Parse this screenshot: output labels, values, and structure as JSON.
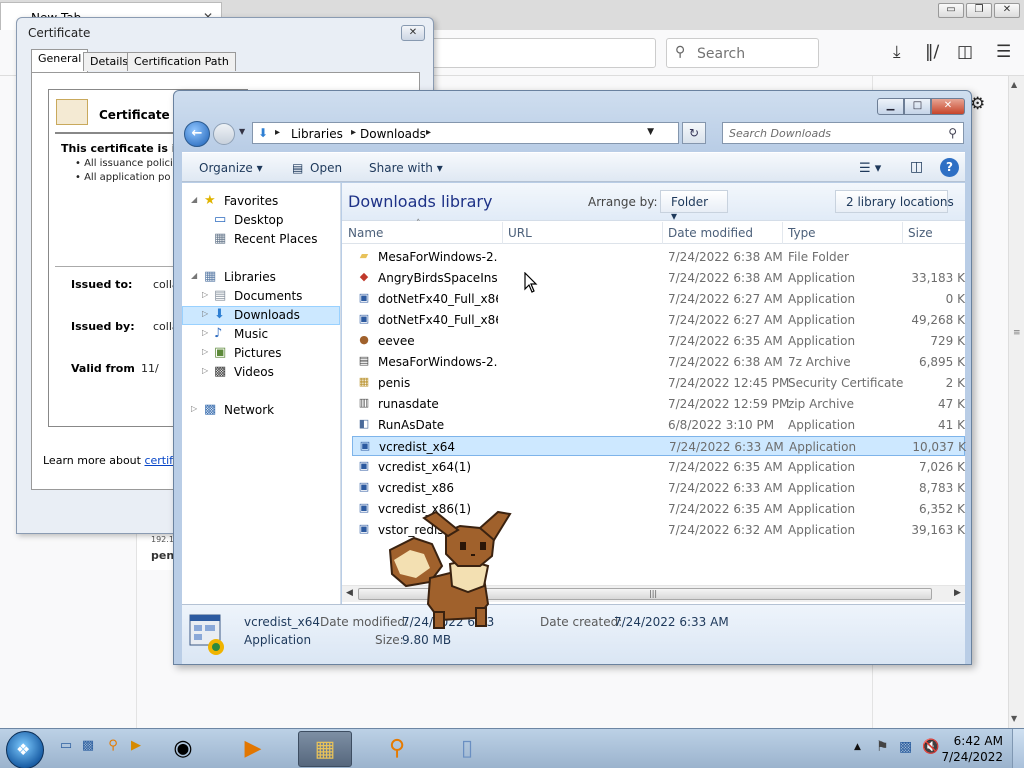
{
  "browser": {
    "tab_title": "New Tab",
    "search_placeholder": "Search",
    "win_min": "▭",
    "win_max": "❐",
    "win_close": "✕",
    "tab_close": "✕",
    "card_ip": "192.1",
    "card_name": "pen"
  },
  "cert": {
    "title": "Certificate",
    "close": "✕",
    "tabs": [
      "General",
      "Details",
      "Certification Path"
    ],
    "info_title": "Certificate Inf",
    "intended": "This certificate is int",
    "bullets": [
      "• All issuance polici",
      "• All application po"
    ],
    "issued_to_label": "Issued to:",
    "issued_to_value": "colla",
    "issued_by_label": "Issued by:",
    "issued_by_value": "colla",
    "valid_from_label": "Valid from",
    "valid_from_value": "11/",
    "learn_prefix": "Learn more about ",
    "learn_link": "certificat"
  },
  "explorer": {
    "title_buttons": {
      "min": "▁",
      "max": "□",
      "close": "✕"
    },
    "address": {
      "crumbs": [
        "Libraries",
        "Downloads"
      ]
    },
    "search_placeholder": "Search Downloads",
    "commands": {
      "organize": "Organize ▾",
      "open": "Open",
      "share": "Share with ▾"
    },
    "help": "?",
    "nav": {
      "favorites": "Favorites",
      "desktop": "Desktop",
      "recent": "Recent Places",
      "libraries": "Libraries",
      "documents": "Documents",
      "downloads": "Downloads",
      "music": "Music",
      "pictures": "Pictures",
      "videos": "Videos",
      "network": "Network"
    },
    "library_title": "Downloads library",
    "arrange_label": "Arrange by:",
    "arrange_value": "Folder ▾",
    "library_locations": "2 library locations",
    "columns": [
      "Name",
      "URL",
      "Date modified",
      "Type",
      "Size"
    ],
    "files": [
      {
        "name": "MesaForWindows-2...",
        "date": "7/24/2022 6:38 AM",
        "type": "File Folder",
        "size": "",
        "icon": "folder-icon",
        "glyph": "▰",
        "color": "#e8c25a"
      },
      {
        "name": "AngryBirdsSpaceIns...",
        "date": "7/24/2022 6:38 AM",
        "type": "Application",
        "size": "33,183 K",
        "icon": "angry-birds-icon",
        "glyph": "◆",
        "color": "#c0392b"
      },
      {
        "name": "dotNetFx40_Full_x86...",
        "date": "7/24/2022 6:27 AM",
        "type": "Application",
        "size": "0 K",
        "icon": "installer-icon",
        "glyph": "▣",
        "color": "#2c5aa0"
      },
      {
        "name": "dotNetFx40_Full_x86...",
        "date": "7/24/2022 6:27 AM",
        "type": "Application",
        "size": "49,268 K",
        "icon": "installer-icon",
        "glyph": "▣",
        "color": "#2c5aa0"
      },
      {
        "name": "eevee",
        "date": "7/24/2022 6:35 AM",
        "type": "Application",
        "size": "729 K",
        "icon": "eevee-icon",
        "glyph": "●",
        "color": "#a0612c"
      },
      {
        "name": "MesaForWindows-2...",
        "date": "7/24/2022 6:38 AM",
        "type": "7z Archive",
        "size": "6,895 K",
        "icon": "archive-icon",
        "glyph": "▤",
        "color": "#444"
      },
      {
        "name": "penis",
        "date": "7/24/2022 12:45 PM",
        "type": "Security Certificate",
        "size": "2 K",
        "icon": "certificate-icon",
        "glyph": "▦",
        "color": "#b8902a"
      },
      {
        "name": "runasdate",
        "date": "7/24/2022 12:59 PM",
        "type": "zip Archive",
        "size": "47 K",
        "icon": "zip-icon",
        "glyph": "▥",
        "color": "#555"
      },
      {
        "name": "RunAsDate",
        "date": "6/8/2022 3:10 PM",
        "type": "Application",
        "size": "41 K",
        "icon": "app-icon",
        "glyph": "◧",
        "color": "#4a6a9a"
      },
      {
        "name": "vcredist_x64",
        "date": "7/24/2022 6:33 AM",
        "type": "Application",
        "size": "10,037 K",
        "icon": "installer-icon",
        "glyph": "▣",
        "color": "#2c5aa0"
      },
      {
        "name": "vcredist_x64(1)",
        "date": "7/24/2022 6:35 AM",
        "type": "Application",
        "size": "7,026 K",
        "icon": "installer-icon",
        "glyph": "▣",
        "color": "#2c5aa0"
      },
      {
        "name": "vcredist_x86",
        "date": "7/24/2022 6:33 AM",
        "type": "Application",
        "size": "8,783 K",
        "icon": "installer-icon",
        "glyph": "▣",
        "color": "#2c5aa0"
      },
      {
        "name": "vcredist_x86(1)",
        "date": "7/24/2022 6:35 AM",
        "type": "Application",
        "size": "6,352 K",
        "icon": "installer-icon",
        "glyph": "▣",
        "color": "#2c5aa0"
      },
      {
        "name": "vstor_redist",
        "date": "7/24/2022 6:32 AM",
        "type": "Application",
        "size": "39,163 K",
        "icon": "installer-icon",
        "glyph": "▣",
        "color": "#2c5aa0"
      }
    ],
    "selected_index": 9,
    "details": {
      "name": "vcredist_x64",
      "kind": "Application",
      "modified_label": "Date modified:",
      "modified_value": "7/24/2022 6:33",
      "size_label": "Size:",
      "size_value": "9.80 MB",
      "created_label": "Date created:",
      "created_value": "7/24/2022 6:33 AM"
    }
  },
  "taskbar": {
    "clock_time": "6:42 AM",
    "clock_date": "7/24/2022"
  }
}
